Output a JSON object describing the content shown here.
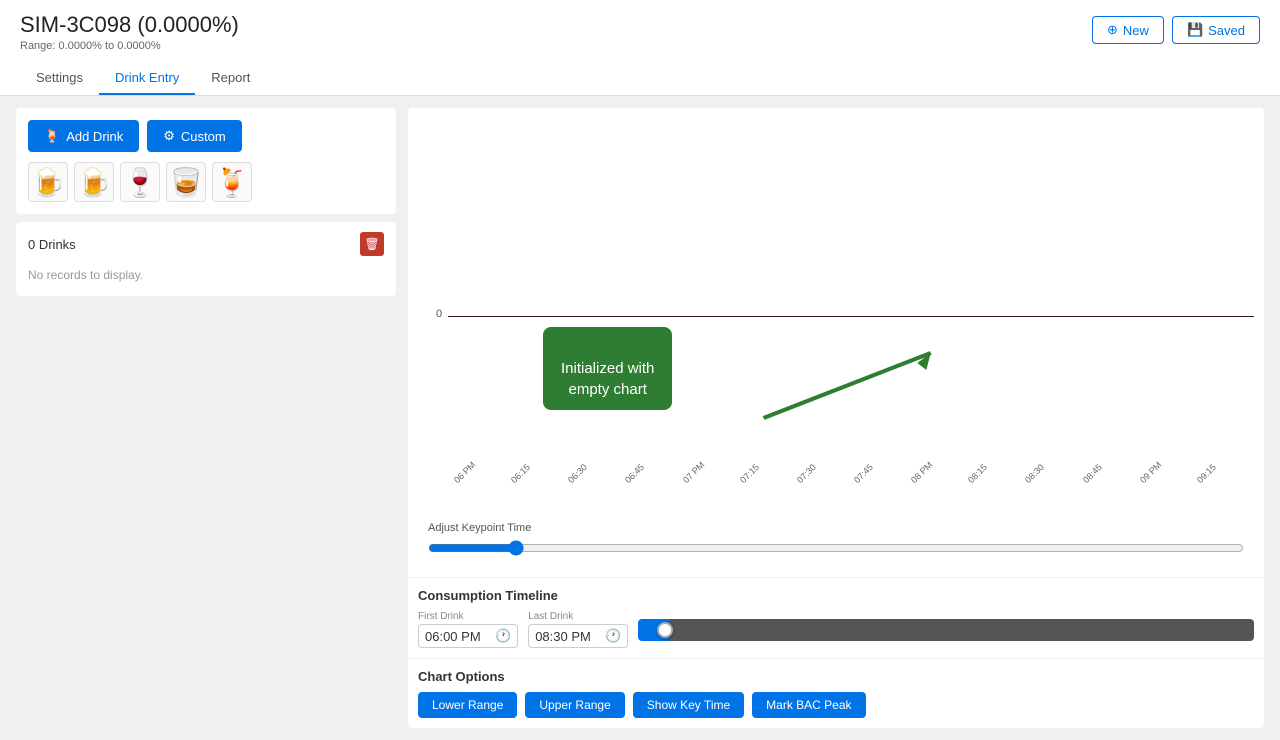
{
  "header": {
    "title": "SIM-3C098 (0.0000%)",
    "range": "Range: 0.0000% to 0.0000%",
    "new_button": "New",
    "saved_button": "Saved"
  },
  "tabs": [
    {
      "label": "Settings",
      "active": false
    },
    {
      "label": "Drink Entry",
      "active": true
    },
    {
      "label": "Report",
      "active": false
    }
  ],
  "drink_entry": {
    "add_drink_label": "Add Drink",
    "custom_label": "Custom",
    "drinks_count": "0 Drinks",
    "no_records": "No records to display.",
    "drink_icons": [
      "🍺",
      "🍺",
      "🍷",
      "🥃",
      "🍹"
    ]
  },
  "chart": {
    "zero_label": "0",
    "tooltip_text": "Initialized with\nempty chart",
    "x_labels": [
      "06 PM",
      "06:15",
      "06:30",
      "06:45",
      "07 PM",
      "07:15",
      "07:30",
      "07:45",
      "08 PM",
      "08:15",
      "08:30",
      "08:45",
      "09 PM",
      "09:15"
    ],
    "adjust_keypoint_label": "Adjust Keypoint Time"
  },
  "consumption_timeline": {
    "title": "Consumption Timeline",
    "first_drink_label": "First Drink",
    "first_drink_value": "06:00 PM",
    "last_drink_label": "Last Drink",
    "last_drink_value": "08:30 PM"
  },
  "chart_options": {
    "title": "Chart Options",
    "buttons": [
      "Lower Range",
      "Upper Range",
      "Show Key Time",
      "Mark BAC Peak"
    ]
  }
}
